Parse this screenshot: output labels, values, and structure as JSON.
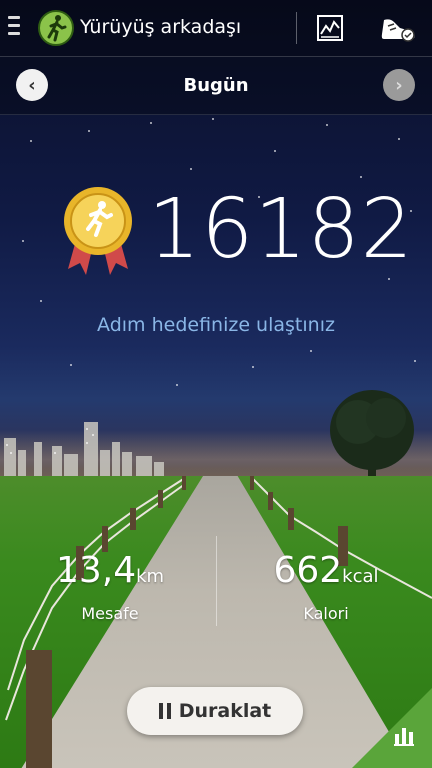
{
  "header": {
    "title": "Yürüyüş arkadaşı",
    "menu_icon": "menu-icon",
    "logo_icon": "walking-person-icon",
    "chart_icon": "chart-icon",
    "shoe_icon": "shoe-icon"
  },
  "datebar": {
    "label": "Bugün",
    "prev_icon": "chevron-left-icon",
    "next_icon": "chevron-right-icon"
  },
  "main": {
    "steps": "16182",
    "medal_icon": "medal-icon",
    "goal_message": "Adım hedefinize ulaştınız"
  },
  "stats": {
    "distance": {
      "value": "13,4",
      "unit": "km",
      "label": "Mesafe"
    },
    "calories": {
      "value": "662",
      "unit": "kcal",
      "label": "Kalori"
    }
  },
  "controls": {
    "pause_label": "Duraklat",
    "pause_icon": "pause-icon",
    "corner_icon": "bar-chart-icon"
  },
  "colors": {
    "goal_text": "#8ab6e6",
    "corner_accent": "#5aa53a",
    "logo_green": "#8bc34a"
  }
}
